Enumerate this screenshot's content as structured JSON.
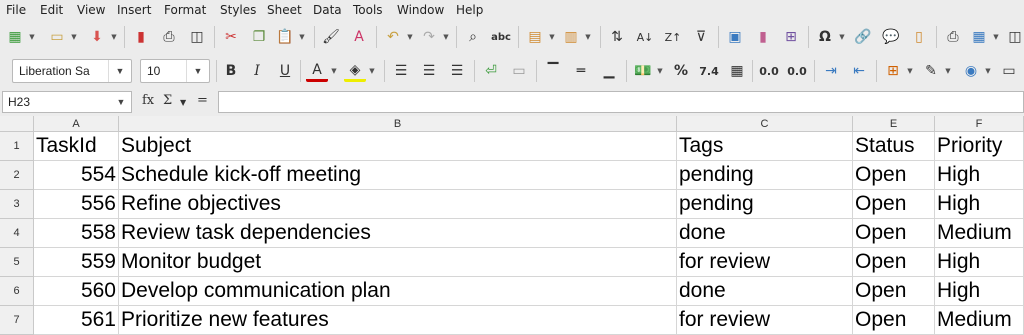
{
  "menu": [
    "File",
    "Edit",
    "View",
    "Insert",
    "Format",
    "Styles",
    "Sheet",
    "Data",
    "Tools",
    "Window",
    "Help"
  ],
  "font": {
    "name": "Liberation Sa",
    "size": "10"
  },
  "formula": {
    "cell_ref": "H23",
    "content": ""
  },
  "columns": [
    "A",
    "B",
    "C",
    "E",
    "F"
  ],
  "rows": [
    {
      "num": "1",
      "cells": [
        "TaskId",
        "Subject",
        "Tags",
        "Status",
        "Priority"
      ]
    },
    {
      "num": "2",
      "cells": [
        "554",
        "Schedule kick-off meeting",
        "pending",
        "Open",
        "High"
      ]
    },
    {
      "num": "3",
      "cells": [
        "556",
        "Refine objectives",
        "pending",
        "Open",
        "High"
      ]
    },
    {
      "num": "4",
      "cells": [
        "558",
        "Review task dependencies",
        "done",
        "Open",
        "Medium"
      ]
    },
    {
      "num": "5",
      "cells": [
        "559",
        "Monitor budget",
        "for review",
        "Open",
        "High"
      ]
    },
    {
      "num": "6",
      "cells": [
        "560",
        "Develop communication plan",
        "done",
        "Open",
        "High"
      ]
    },
    {
      "num": "7",
      "cells": [
        "561",
        "Prioritize new features",
        "for review",
        "Open",
        "Medium"
      ]
    }
  ]
}
